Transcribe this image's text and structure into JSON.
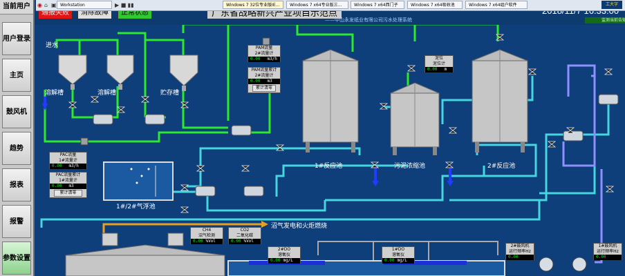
{
  "sidebar": {
    "current_user": "当前用户",
    "items": [
      {
        "label": "用户登录"
      },
      {
        "label": "主页"
      },
      {
        "label": "鼓风机"
      },
      {
        "label": "趋势"
      },
      {
        "label": "报表"
      },
      {
        "label": "报警"
      },
      {
        "label": "参数设置"
      }
    ]
  },
  "header": {
    "alarm_report": "通报失败",
    "fault": "消除故障",
    "normal": "正常状态",
    "title": "广东省战略新兴产业项目示范点",
    "subtitle": "——中山永发纸业有限公司污水处理系统",
    "datetime": "2018/11/7 16:33:00",
    "marquee": "监测当前告知信息"
  },
  "taskbar": {
    "tabs": [
      {
        "label": "Workstation"
      },
      {
        "label": "Windows 7 32位专业版IE..."
      },
      {
        "label": "Windows 7 x64专业版三..."
      },
      {
        "label": "Windows 7 x64西门子"
      },
      {
        "label": "Windows 7 x64吸收池"
      },
      {
        "label": "Windows 7 x64组户软件"
      }
    ],
    "user": "工大字"
  },
  "process": {
    "water_inlet": "进水",
    "tank1": "溶解槽",
    "tank2": "溶解槽",
    "tank3": "贮存槽",
    "reactor1": "1#反应池",
    "sludge": "污泥浓缩池",
    "reactor2": "2#反应池",
    "flotation": "1#/2#气浮池",
    "gas_gen": "沼气发电和火炬燃烧"
  },
  "panels": {
    "pam_flow": {
      "title": "PAM流量",
      "name": "2#流量计",
      "value": "0.00",
      "unit": "m3/h"
    },
    "pam_total": {
      "title": "PAM流量累计",
      "name": "2#流量计",
      "value": "0.00",
      "unit": "m3",
      "button": "累计清零"
    },
    "sludge": {
      "title": "泥位",
      "name": "泥位计",
      "value": "0.00",
      "unit": "m"
    },
    "pac_flow": {
      "title": "PAC流量",
      "name": "1#流量计",
      "value": "0.00",
      "unit": "m3/h"
    },
    "pac_total": {
      "title": "PAC流量累计",
      "name": "1#流量计",
      "value": "0.00",
      "unit": "m3",
      "button": "累计清零"
    },
    "ch4": {
      "title": "CH4",
      "name": "沼气检测",
      "value": "0.00",
      "unit": "%Vol"
    },
    "co2": {
      "title": "CO2",
      "name": "二氧化碳",
      "value": "0.00",
      "unit": "%Vol"
    },
    "do2": {
      "title": "2#DO",
      "name": "溶氧仪",
      "value": "0.00",
      "unit": "mg/L"
    },
    "do1": {
      "title": "1#DO",
      "name": "溶氧仪",
      "value": "0.00",
      "unit": "mg/L"
    },
    "blower2": {
      "title": "2#鼓风机",
      "name": "运行频率Hz",
      "value": "0.00"
    },
    "blower1": {
      "title": "1#鼓风机",
      "name": "运行频率Hz",
      "value": "0.00"
    }
  }
}
